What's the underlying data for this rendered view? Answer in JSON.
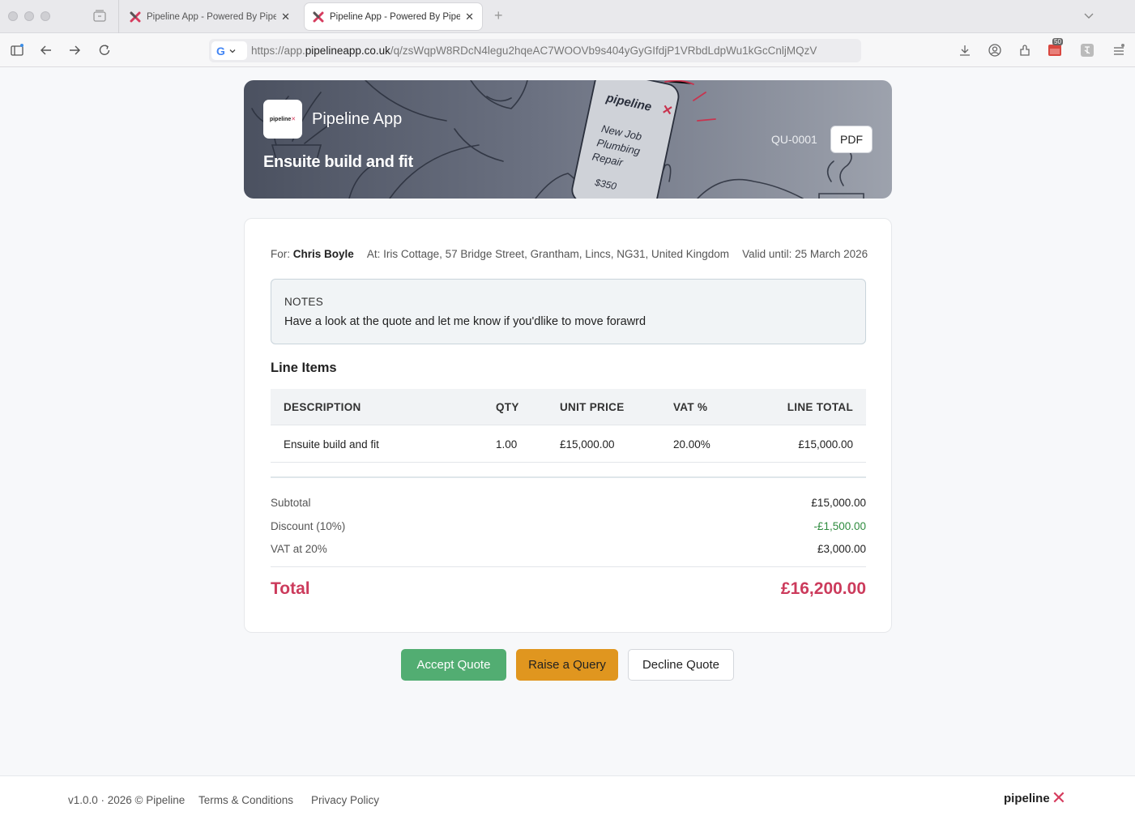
{
  "browser": {
    "tabs": [
      {
        "title": "Pipeline App - Powered By Pipel"
      },
      {
        "title": "Pipeline App - Powered By Pipel"
      }
    ],
    "url_prefix": "https://app.",
    "url_host": "pipelineapp.co.uk",
    "url_path": "/q/zsWqpW8RDcN4legu2hqeAC7WOOVb9s404yGyGIfdjP1VRbdLdpWu1kGcCnljMQzV",
    "search_engine_letter": "G",
    "extension_badge": "50"
  },
  "hero": {
    "logo_text": "pipeline",
    "logo_mark": "✕",
    "app_name": "Pipeline App",
    "job_title": "Ensuite build and fit",
    "quote_number": "QU-0001",
    "pdf_label": "PDF",
    "phone_brand": "pipeline",
    "phone_line1": "New Job",
    "phone_line2": "Plumbing",
    "phone_line3": "Repair",
    "phone_price": "$350"
  },
  "meta": {
    "for_label": "For:",
    "customer": "Chris Boyle",
    "at_label": "At:",
    "address": "Iris Cottage, 57 Bridge Street, Grantham, Lincs, NG31, United Kingdom",
    "valid_label": "Valid until:",
    "valid_date": "25 March 2026"
  },
  "notes": {
    "label": "NOTES",
    "text": "Have a look at the quote and let me know if you'dlike to move forawrd"
  },
  "line_items": {
    "heading": "Line Items",
    "columns": [
      "DESCRIPTION",
      "QTY",
      "UNIT PRICE",
      "VAT %",
      "LINE TOTAL"
    ],
    "rows": [
      {
        "description": "Ensuite build and fit",
        "qty": "1.00",
        "unit_price": "£15,000.00",
        "vat": "20.00%",
        "line_total": "£15,000.00"
      }
    ]
  },
  "summary": {
    "subtotal_label": "Subtotal",
    "subtotal": "£15,000.00",
    "discount_label": "Discount (10%)",
    "discount": "-£1,500.00",
    "vat_label": "VAT at 20%",
    "vat": "£3,000.00",
    "total_label": "Total",
    "total": "£16,200.00"
  },
  "actions": {
    "accept": "Accept Quote",
    "query": "Raise a Query",
    "decline": "Decline Quote"
  },
  "footer": {
    "version": "v1.0.0 · 2026 © Pipeline",
    "terms": "Terms & Conditions",
    "privacy": "Privacy Policy",
    "logo_text": "pipeline",
    "logo_mark": "✕"
  },
  "colors": {
    "accept": "#52ad72",
    "query": "#e0961f",
    "total": "#cc3b5c",
    "discount": "#2e8b3e",
    "brand_x": "#d63c5e"
  }
}
